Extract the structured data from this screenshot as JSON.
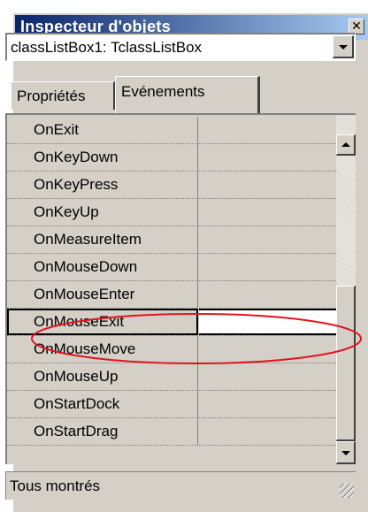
{
  "window": {
    "title": "Inspecteur d'objets",
    "close_glyph": "✕"
  },
  "component_selector": {
    "selected": "classListBox1: TclassListBox"
  },
  "tabs": [
    {
      "label": "Propriétés",
      "active": false
    },
    {
      "label": "Evénements",
      "active": true
    }
  ],
  "events": [
    {
      "name": "OnExit",
      "value": ""
    },
    {
      "name": "OnKeyDown",
      "value": ""
    },
    {
      "name": "OnKeyPress",
      "value": ""
    },
    {
      "name": "OnKeyUp",
      "value": ""
    },
    {
      "name": "OnMeasureItem",
      "value": ""
    },
    {
      "name": "OnMouseDown",
      "value": ""
    },
    {
      "name": "OnMouseEnter",
      "value": ""
    },
    {
      "name": "OnMouseExit",
      "value": "",
      "selected": true
    },
    {
      "name": "OnMouseMove",
      "value": ""
    },
    {
      "name": "OnMouseUp",
      "value": ""
    },
    {
      "name": "OnStartDock",
      "value": ""
    },
    {
      "name": "OnStartDrag",
      "value": ""
    }
  ],
  "status_bar": {
    "text": "Tous montrés"
  },
  "annotation": {
    "color": "#e0141e"
  },
  "colors": {
    "title_start": "#0a246a",
    "title_end": "#a6caf0",
    "face": "#d4d0c8"
  }
}
